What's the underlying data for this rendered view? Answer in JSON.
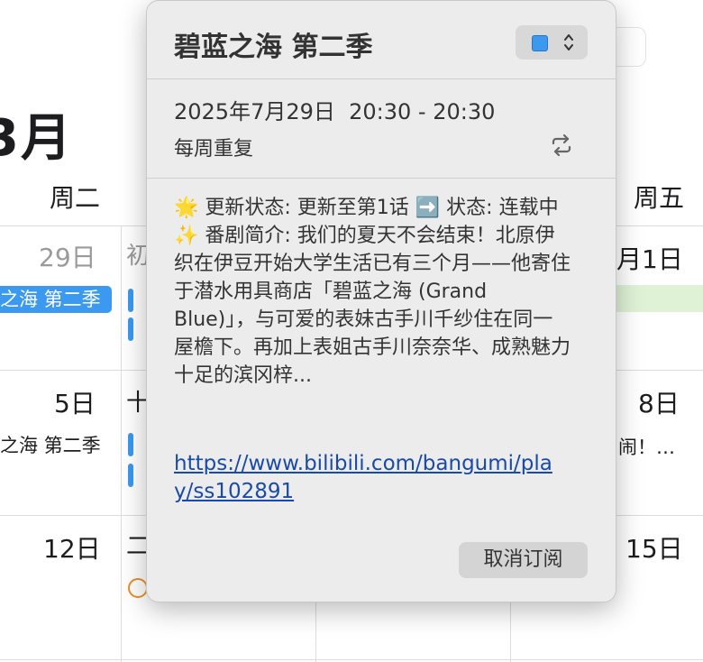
{
  "calendar": {
    "month_label": "3月",
    "day_headers": {
      "tue": "周二",
      "fri": "周五"
    },
    "partial_cells": {
      "wed_row1": "初",
      "wed_row2": "十",
      "wed_row3": "二"
    },
    "dates": {
      "r1_tue": "29日",
      "r1_fri": "月1日",
      "r2_tue": "5日",
      "r2_fri": "8日",
      "r3_tue": "12日",
      "r3_fri": "15日"
    },
    "events": {
      "r1_bar": "之海 第二季",
      "r2_text": "之海 第二季",
      "r2_fri_text": "闹！…"
    }
  },
  "popover": {
    "title": "碧蓝之海 第二季",
    "calendar_color": "#3b99f0",
    "datetime": "2025年7月29日  20:30 - 20:30",
    "repeat_label": "每周重复",
    "description": "🌟 更新状态: 更新至第1话 ➡️ 状态: 连载中 ✨ 番剧简介: 我们的夏天不会结束！北原伊织在伊豆开始大学生活已有三个月——他寄住于潜水用具商店「碧蓝之海 (Grand Blue)」，与可爱的表妹古手川千纱住在同一屋檐下。再加上表姐古手川奈奈华、成熟魅力十足的滨冈梓...",
    "link": "https://www.bilibili.com/bangumi/play/ss102891",
    "unsubscribe_label": "取消订阅"
  }
}
